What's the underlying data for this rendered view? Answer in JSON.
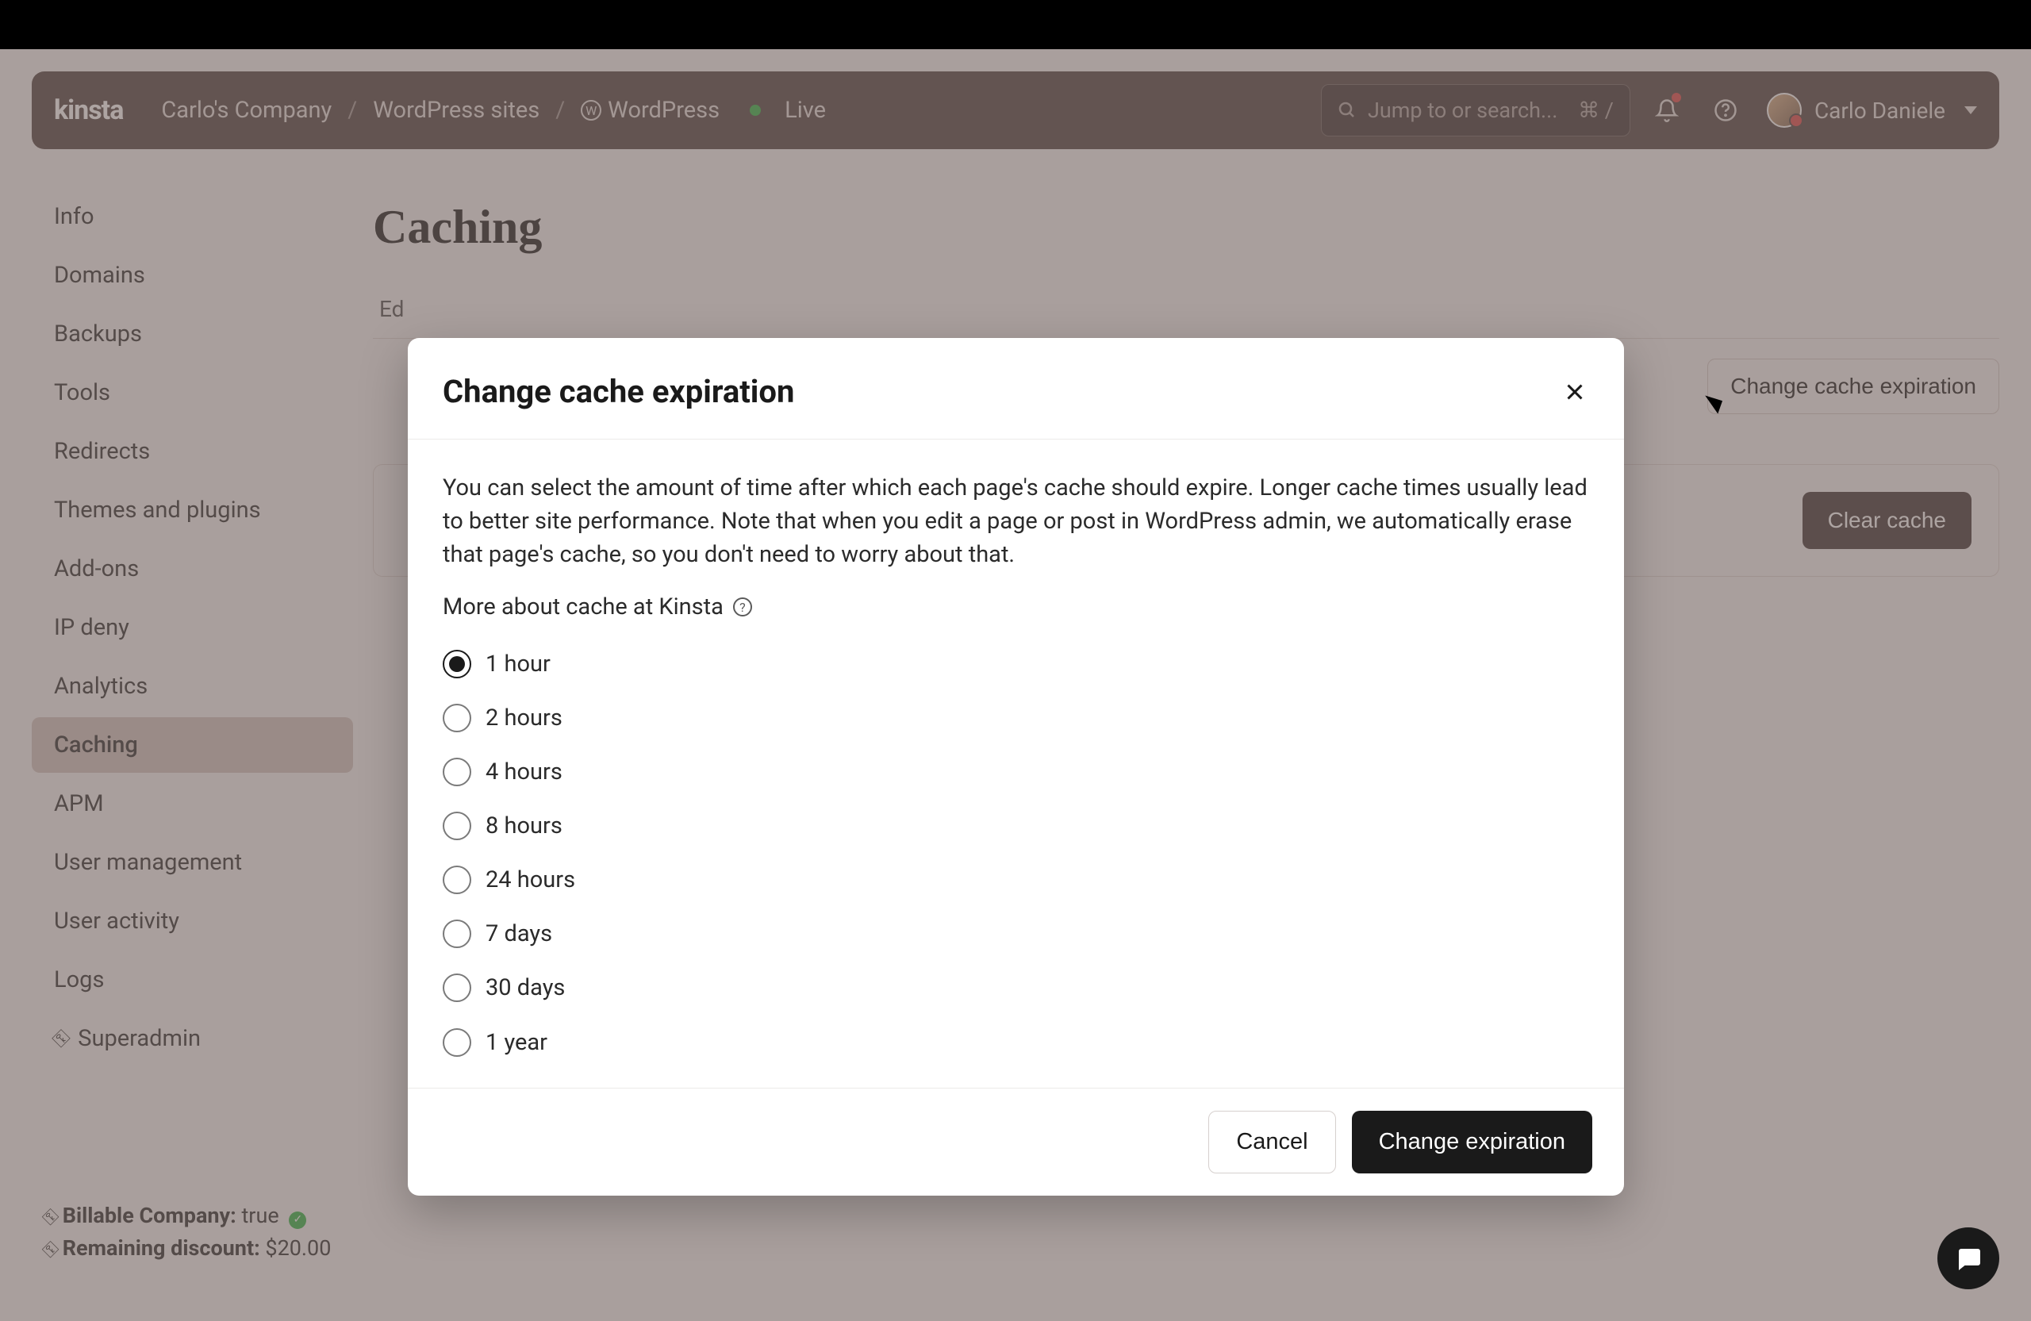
{
  "topbar": {
    "logo": "kinsta",
    "breadcrumbs": [
      "Carlo's Company",
      "WordPress sites",
      "WordPress"
    ],
    "env_label": "Live",
    "search_placeholder": "Jump to or search...",
    "search_kbd": "⌘ /",
    "user_name": "Carlo Daniele"
  },
  "sidebar": {
    "items": [
      "Info",
      "Domains",
      "Backups",
      "Tools",
      "Redirects",
      "Themes and plugins",
      "Add-ons",
      "IP deny",
      "Analytics",
      "Caching",
      "APM",
      "User management",
      "User activity",
      "Logs",
      "Superadmin"
    ],
    "active_index": 9
  },
  "footer": {
    "billable_label": "Billable Company:",
    "billable_value": "true",
    "discount_label": "Remaining discount:",
    "discount_value": "$20.00"
  },
  "page": {
    "title": "Caching",
    "change_btn": "Change cache expiration",
    "clear_btn": "Clear cache",
    "tab_partial": "Ed"
  },
  "modal": {
    "title": "Change cache expiration",
    "body": "You can select the amount of time after which each page's cache should expire. Longer cache times usually lead to better site performance. Note that when you edit a page or post in WordPress admin, we automatically erase that page's cache, so you don't need to worry about that.",
    "more_link": "More about cache at Kinsta",
    "options": [
      "1 hour",
      "2 hours",
      "4 hours",
      "8 hours",
      "24 hours",
      "7 days",
      "30 days",
      "1 year"
    ],
    "selected_index": 0,
    "cancel": "Cancel",
    "confirm": "Change expiration"
  }
}
